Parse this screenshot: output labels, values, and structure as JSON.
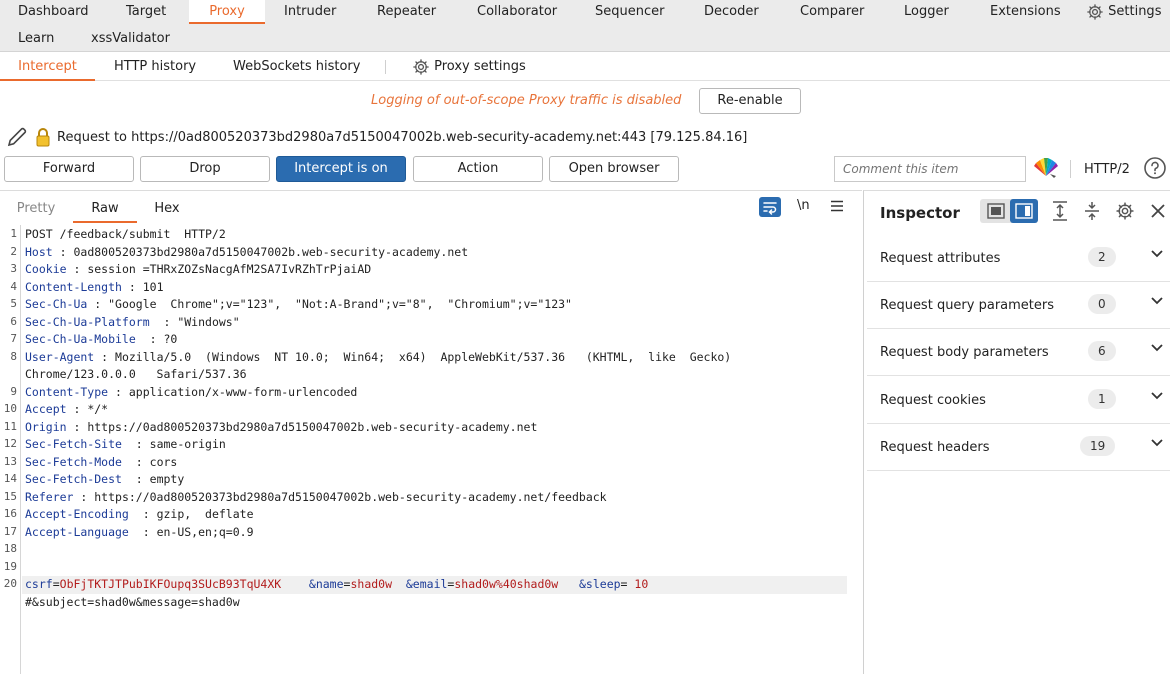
{
  "top_tabs_row1": [
    "Dashboard",
    "Target",
    "Proxy",
    "Intruder",
    "Repeater",
    "Collaborator",
    "Sequencer",
    "Decoder",
    "Comparer",
    "Logger",
    "Extensions",
    "Settings"
  ],
  "top_tabs_row2": [
    "Learn",
    "xssValidator"
  ],
  "active_top_tab": "Proxy",
  "proxy_tabs": [
    "Intercept",
    "HTTP history",
    "WebSockets history",
    "Proxy settings"
  ],
  "notice": "Logging of out-of-scope Proxy traffic is disabled",
  "reenable_label": "Re-enable",
  "request_line": "Request to https://0ad800520373bd2980a7d5150047002b.web-security-academy.net:443   [79.125.84.16]",
  "toolbar": {
    "forward": "Forward",
    "drop": "Drop",
    "intercept": "Intercept is on",
    "action": "Action",
    "open_browser": "Open browser",
    "comment_placeholder": "Comment this item",
    "http_version": "HTTP/2"
  },
  "editor_tabs": [
    "Pretty",
    "Raw",
    "Hex"
  ],
  "active_editor_tab": "Raw",
  "editor_icons": {
    "newline_label": "\\n"
  },
  "request_lines": [
    {
      "n": "1",
      "text": "POST /feedback/submit  HTTP/2"
    },
    {
      "n": "2",
      "key": "Host",
      "sep": " : ",
      "val": "0ad800520373bd2980a7d5150047002b.web-security-academy.net"
    },
    {
      "n": "3",
      "key": "Cookie",
      "sep": " : ",
      "val": "session =THRxZOZsNacgAfM2SA7IvRZhTrPjaiAD"
    },
    {
      "n": "4",
      "key": "Content-Length",
      "sep": " : ",
      "val": "101"
    },
    {
      "n": "5",
      "key": "Sec-Ch-Ua",
      "sep": " : ",
      "val": "\"Google  Chrome\";v=\"123\",  \"Not:A-Brand\";v=\"8\",  \"Chromium\";v=\"123\""
    },
    {
      "n": "6",
      "key": "Sec-Ch-Ua-Platform",
      "sep": "  : ",
      "val": "\"Windows\""
    },
    {
      "n": "7",
      "key": "Sec-Ch-Ua-Mobile",
      "sep": "  : ",
      "val": "?0"
    },
    {
      "n": "8",
      "key": "User-Agent",
      "sep": " : ",
      "val": "Mozilla/5.0  (Windows  NT 10.0;  Win64;  x64)  AppleWebKit/537.36   (KHTML,  like  Gecko)"
    },
    {
      "n": "",
      "text": "Chrome/123.0.0.0   Safari/537.36"
    },
    {
      "n": "9",
      "key": "Content-Type",
      "sep": " : ",
      "val": "application/x-www-form-urlencoded"
    },
    {
      "n": "10",
      "key": "Accept",
      "sep": " : ",
      "val": "*/*"
    },
    {
      "n": "11",
      "key": "Origin",
      "sep": " : ",
      "val": "https://0ad800520373bd2980a7d5150047002b.web-security-academy.net"
    },
    {
      "n": "12",
      "key": "Sec-Fetch-Site",
      "sep": "  : ",
      "val": "same-origin"
    },
    {
      "n": "13",
      "key": "Sec-Fetch-Mode",
      "sep": "  : ",
      "val": "cors"
    },
    {
      "n": "14",
      "key": "Sec-Fetch-Dest",
      "sep": "  : ",
      "val": "empty"
    },
    {
      "n": "15",
      "key": "Referer",
      "sep": " : ",
      "val": "https://0ad800520373bd2980a7d5150047002b.web-security-academy.net/feedback"
    },
    {
      "n": "16",
      "key": "Accept-Encoding",
      "sep": "  : ",
      "val": "gzip,  deflate"
    },
    {
      "n": "17",
      "key": "Accept-Language",
      "sep": "  : ",
      "val": "en-US,en;q=0.9"
    },
    {
      "n": "18",
      "text": ""
    },
    {
      "n": "19",
      "text": ""
    }
  ],
  "body_params": [
    {
      "key": "csrf",
      "val": "ObFjTKTJTPubIKFOupq3SUcB93TqU4XK  "
    },
    {
      "key": "&name",
      "val": "shad0w"
    },
    {
      "key": "&email",
      "val": "shad0w%40shad0w "
    },
    {
      "key": "&sleep",
      "val": " 10"
    }
  ],
  "body_line2": "#&subject=shad0w&message=shad0w",
  "inspector": {
    "title": "Inspector",
    "rows": [
      {
        "label": "Request attributes",
        "count": "2"
      },
      {
        "label": "Request query parameters",
        "count": "0"
      },
      {
        "label": "Request body parameters",
        "count": "6"
      },
      {
        "label": "Request cookies",
        "count": "1"
      },
      {
        "label": "Request headers",
        "count": "19"
      }
    ]
  },
  "colors": {
    "accent": "#ea6a2d",
    "intercept_blue": "#2b6cb0",
    "header_key": "#1c3b97",
    "param_value": "#b21c1c"
  }
}
